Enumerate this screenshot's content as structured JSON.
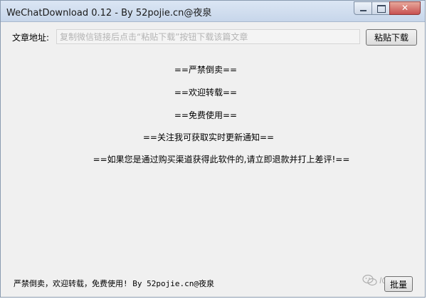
{
  "window": {
    "title": "WeChatDownload 0.12 - By 52pojie.cn@夜泉",
    "caption": {
      "minimize_icon": "minimize-icon",
      "maximize_icon": "maximize-icon",
      "close_icon": "close-icon",
      "close_glyph": "✕"
    }
  },
  "url_row": {
    "label": "文章地址:",
    "placeholder": "复制微信链接后点击“粘贴下载”按钮下载该篇文章",
    "value": "",
    "paste_button": "粘贴下载"
  },
  "notices": [
    "==严禁倒卖==",
    "==欢迎转载==",
    "==免费使用==",
    "==关注我可获取实时更新通知==",
    "==如果您是通过购买渠道获得此软件的,请立即退款并打上差评!=="
  ],
  "footer": {
    "text": "严禁倒卖，欢迎转载，免费使用!   By 52pojie.cn@夜泉",
    "batch_button": "批量"
  },
  "watermark": {
    "icon": "wechat-logo-icon",
    "text": "IQPark"
  },
  "colors": {
    "window_bg": "#f0f0f0",
    "titlebar": "#c7d6ea",
    "close_button": "#c75050"
  }
}
